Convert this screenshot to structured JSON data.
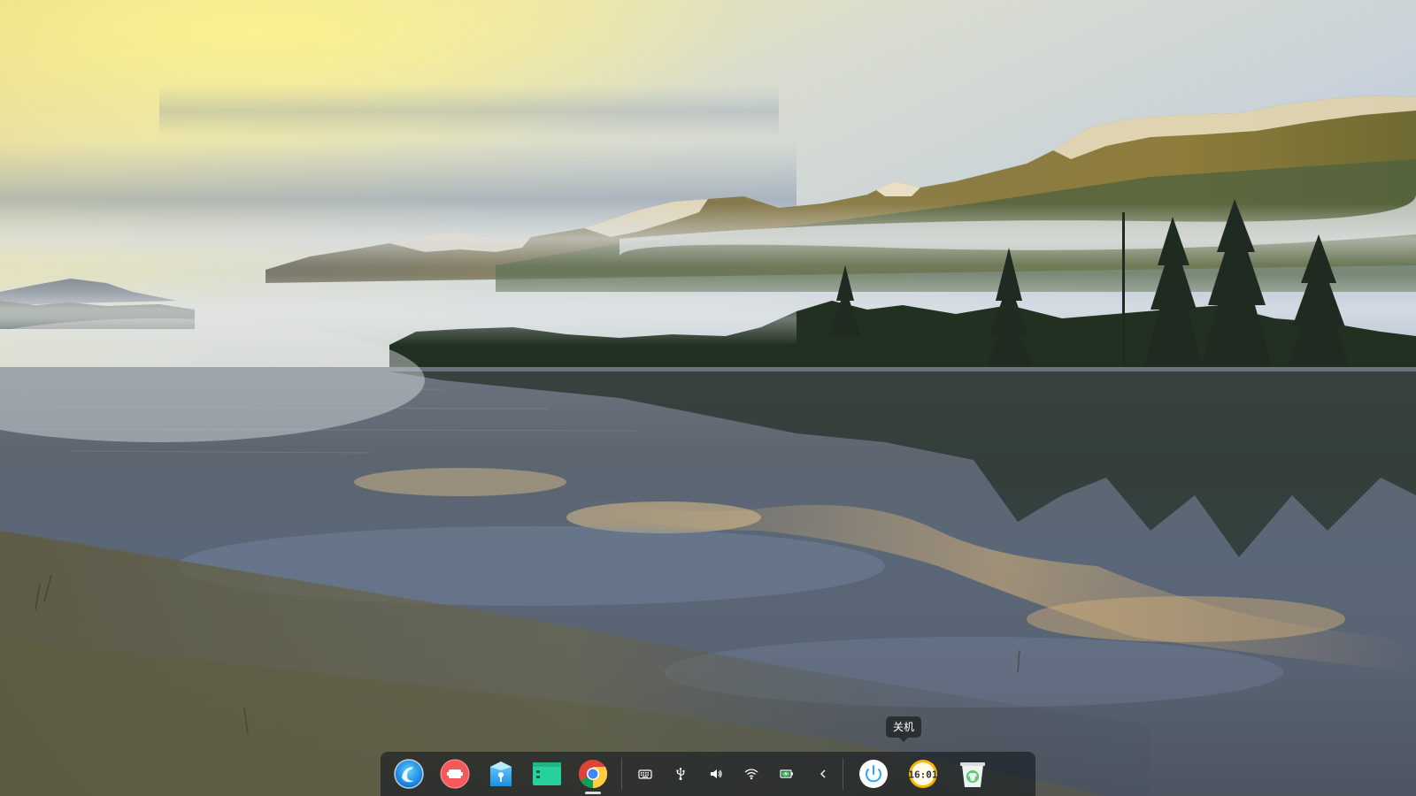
{
  "tooltip": {
    "text": "关机"
  },
  "dock": {
    "apps": [
      {
        "name": "launcher",
        "icon": "deepin-launcher-icon",
        "running": false
      },
      {
        "name": "screen-recorder",
        "icon": "screen-recorder-icon",
        "running": false
      },
      {
        "name": "app-store",
        "icon": "app-store-icon",
        "running": false
      },
      {
        "name": "terminal",
        "icon": "terminal-icon",
        "running": false
      },
      {
        "name": "chrome",
        "icon": "chrome-icon",
        "running": true
      }
    ],
    "tray": [
      {
        "name": "keyboard",
        "icon": "keyboard-icon"
      },
      {
        "name": "usb",
        "icon": "usb-icon"
      },
      {
        "name": "volume",
        "icon": "volume-icon"
      },
      {
        "name": "wifi",
        "icon": "wifi-icon"
      },
      {
        "name": "battery",
        "icon": "battery-charging-icon"
      }
    ],
    "collapse_icon": "chevron-left-icon",
    "system": [
      {
        "name": "shutdown",
        "icon": "power-icon"
      },
      {
        "name": "clock",
        "icon": "clock-icon",
        "text": "16:01"
      },
      {
        "name": "trash",
        "icon": "trash-icon"
      }
    ]
  },
  "colors": {
    "dock_bg": "#14181e",
    "accent_blue": "#2ca7f8",
    "clock_yellow": "#f5b800",
    "terminal_green": "#27d19b",
    "recorder_red": "#f45a5a"
  }
}
